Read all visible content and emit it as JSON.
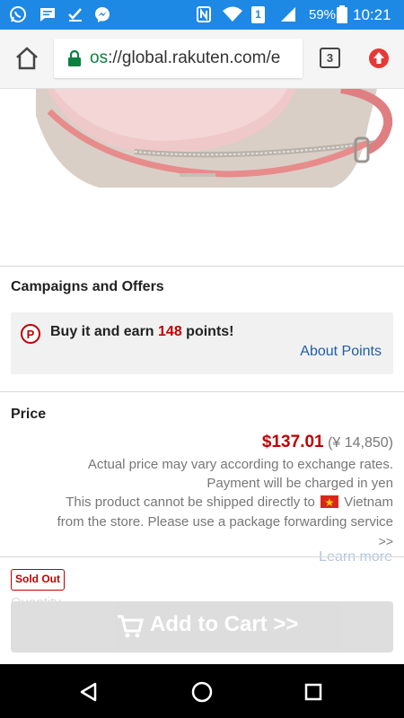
{
  "status_bar": {
    "battery": "59%",
    "time": "10:21",
    "notification_count": "1",
    "icons": [
      "whatsapp-icon",
      "message-icon",
      "check-icon",
      "messenger-icon",
      "nfc-icon",
      "wifi-icon",
      "sim-icon",
      "signal-icon",
      "battery-icon"
    ]
  },
  "browser": {
    "url_scheme": "os",
    "url_rest": "://global.rakuten.com/e",
    "tab_count": "3",
    "icons": [
      "home-icon",
      "lock-icon",
      "update-icon"
    ]
  },
  "campaigns": {
    "title": "Campaigns and Offers",
    "points_prefix": "Buy it and earn ",
    "points_value": "148",
    "points_suffix": " points!",
    "points_badge": "P",
    "about_points": "About Points"
  },
  "price": {
    "title": "Price",
    "usd": "$137.01",
    "jpy": "(¥ 14,850)",
    "note_1": "Actual price may vary according to exchange rates.",
    "note_2": "Payment will be charged in yen",
    "note_3_prefix": "This product cannot be shipped directly to",
    "note_3_country": "Vietnam",
    "note_4": "from the store. Please use a package forwarding service",
    "note_5": ">>",
    "learn_more": "Learn more"
  },
  "product": {
    "sold_out": "Sold Out",
    "quantity_label": "Quantity",
    "add_to_cart": "Add to Cart >>"
  },
  "colors": {
    "status_bar": "#1e88e5",
    "price_red": "#bf0000",
    "link_blue": "#1f5fa8"
  }
}
